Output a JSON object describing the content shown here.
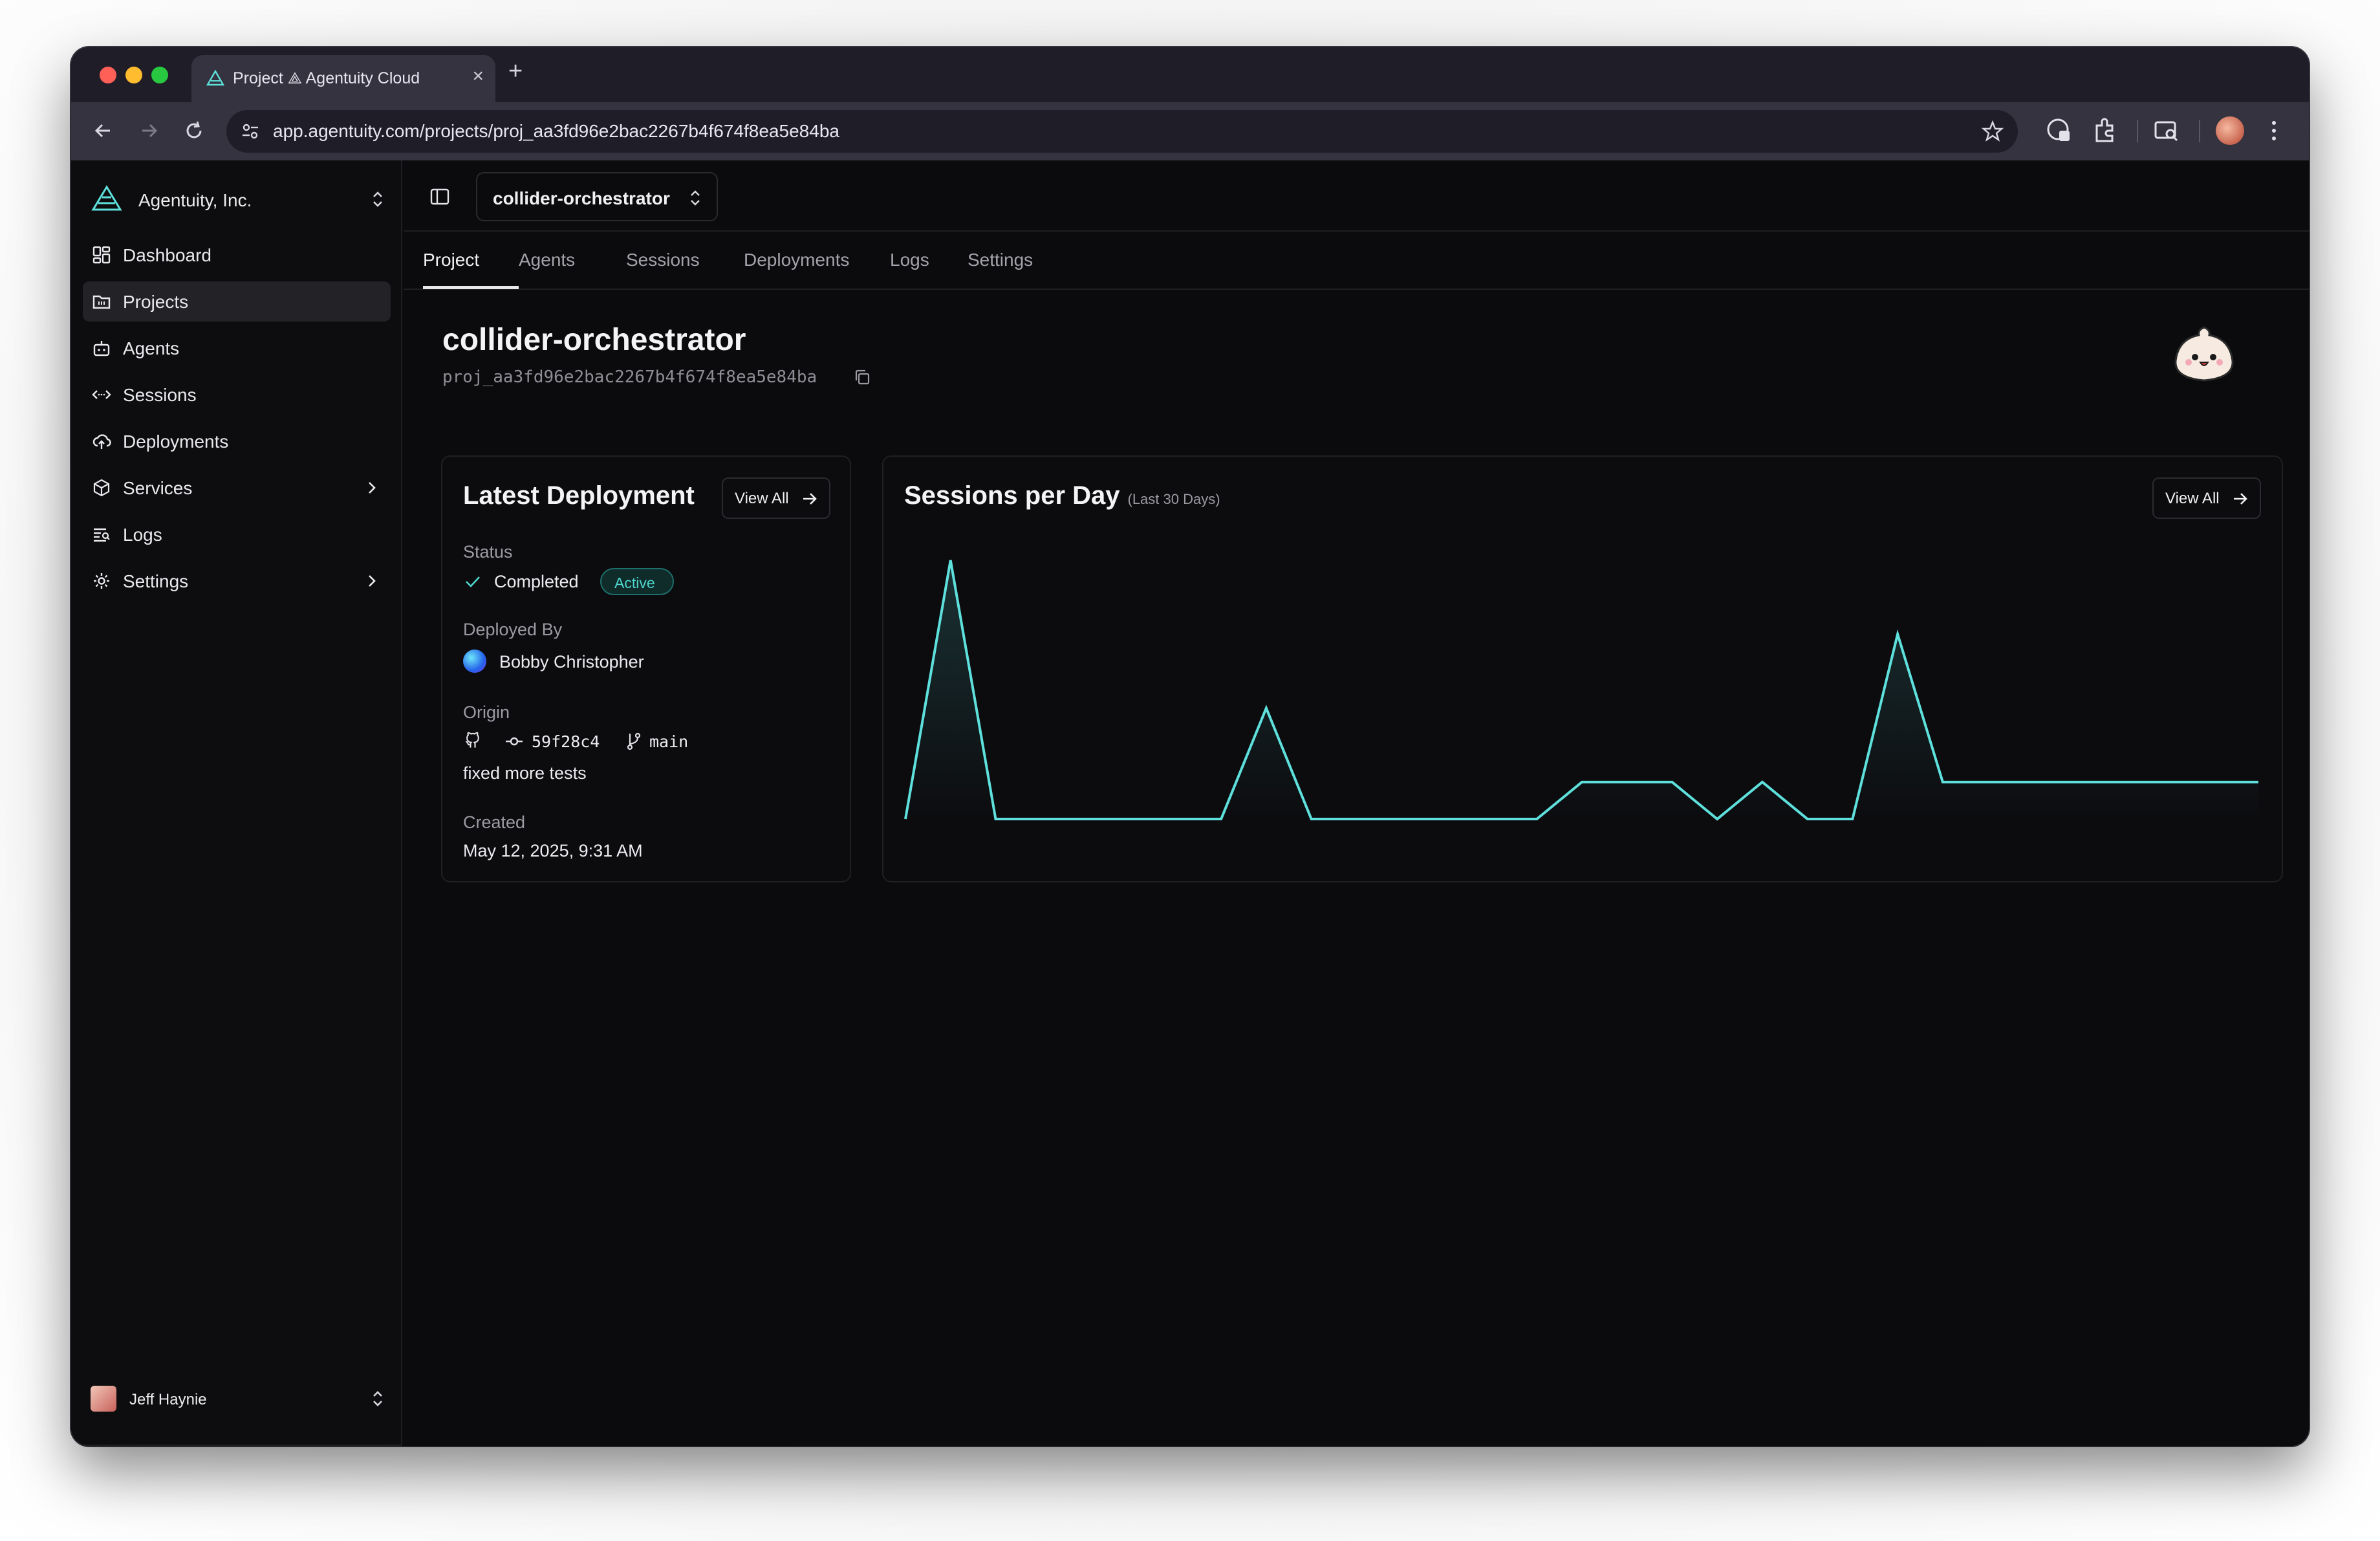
{
  "browser": {
    "tab_title": "Project ⟁ Agentuity Cloud",
    "new_tab": "+",
    "close": "×",
    "url": "app.agentuity.com/projects/proj_aa3fd96e2bac2267b4f674f8ea5e84ba"
  },
  "sidebar": {
    "org_name": "Agentuity, Inc.",
    "items": [
      {
        "label": "Dashboard",
        "icon": "dashboard-icon"
      },
      {
        "label": "Projects",
        "icon": "folder-icon"
      },
      {
        "label": "Agents",
        "icon": "robot-icon"
      },
      {
        "label": "Sessions",
        "icon": "sessions-icon"
      },
      {
        "label": "Deployments",
        "icon": "cloud-upload-icon"
      },
      {
        "label": "Services",
        "icon": "package-icon"
      },
      {
        "label": "Logs",
        "icon": "logs-icon"
      },
      {
        "label": "Settings",
        "icon": "gear-icon"
      }
    ],
    "active_item": "Projects",
    "user_name": "Jeff Haynie"
  },
  "topbar": {
    "project_selector": "collider-orchestrator"
  },
  "tabs": [
    "Project",
    "Agents",
    "Sessions",
    "Deployments",
    "Logs",
    "Settings"
  ],
  "active_tab": "Project",
  "project": {
    "name": "collider-orchestrator",
    "id": "proj_aa3fd96e2bac2267b4f674f8ea5e84ba"
  },
  "latest_deployment": {
    "title": "Latest Deployment",
    "view_all": "View All",
    "status_label": "Status",
    "status_value": "Completed",
    "status_badge": "Active",
    "deployed_by_label": "Deployed By",
    "deployed_by_value": "Bobby Christopher",
    "origin_label": "Origin",
    "commit": "59f28c4",
    "branch": "main",
    "commit_message": "fixed more tests",
    "created_label": "Created",
    "created_value": "May 12, 2025, 9:31 AM"
  },
  "sessions_card": {
    "title": "Sessions per Day",
    "subtitle": "(Last 30 Days)",
    "view_all": "View All"
  },
  "colors": {
    "accent": "#5ee0dc",
    "background": "#0b0b0d",
    "badge_text": "#4fd6cd"
  },
  "chart_data": {
    "type": "area",
    "title": "Sessions per Day",
    "subtitle": "(Last 30 Days)",
    "xlabel": "",
    "ylabel": "",
    "grid": false,
    "x": [
      1,
      2,
      3,
      4,
      5,
      6,
      7,
      8,
      9,
      10,
      11,
      12,
      13,
      14,
      15,
      16,
      17,
      18,
      19,
      20,
      21,
      22,
      23,
      24,
      25,
      26,
      27,
      28,
      29,
      30,
      31
    ],
    "values": [
      0,
      7,
      0,
      0,
      0,
      0,
      0,
      0,
      3,
      0,
      0,
      0,
      0,
      0,
      0,
      1,
      1,
      1,
      0,
      1,
      0,
      0,
      5,
      1,
      1,
      1,
      1,
      1,
      1,
      1,
      1
    ],
    "ylim": [
      0,
      7
    ]
  }
}
